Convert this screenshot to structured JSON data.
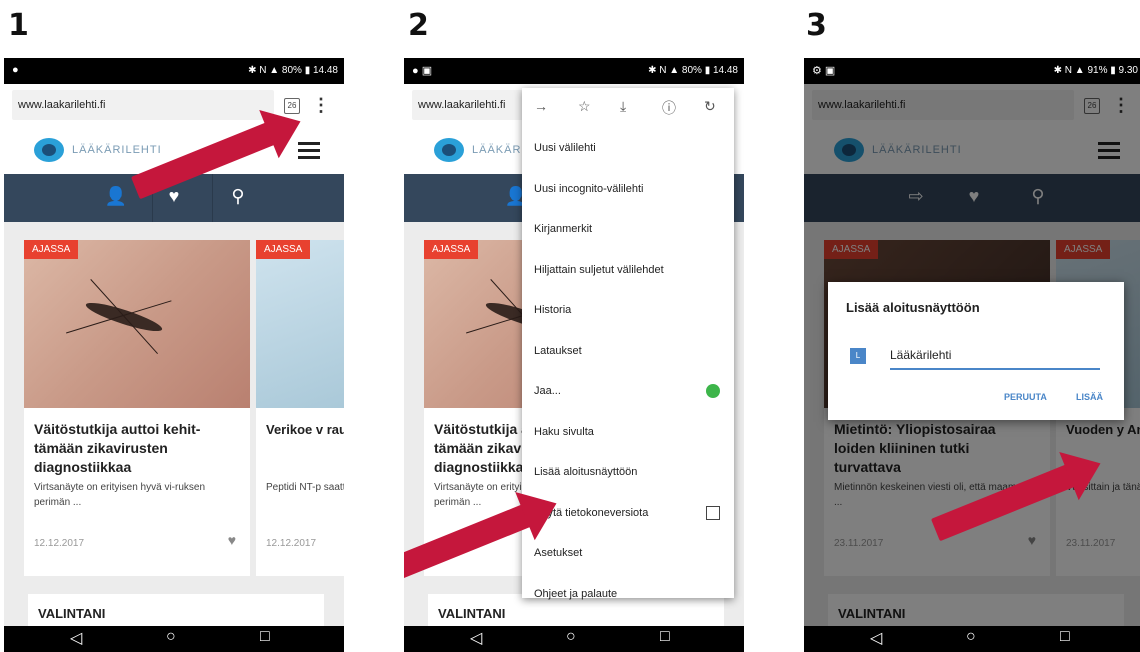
{
  "steps": [
    "1",
    "2",
    "3"
  ],
  "status": {
    "p1": "✱ N ▲ 80% ▮ 14.48",
    "p2": "✱ N ▲ 80% ▮ 14.48",
    "p3": "✱ N ▲ 91% ▮ 9.30"
  },
  "url": "www.laakarilehti.fi",
  "logo_text": "LÄÄKÄRILEHTI",
  "tabs_count": "26",
  "nav_icons": [
    "user-icon",
    "heart-icon",
    "search-icon"
  ],
  "nav_icons_p3": [
    "logout-icon",
    "heart-icon",
    "search-icon"
  ],
  "article1": {
    "tag": "AJASSA",
    "title": "Väitöstutkija auttoi kehit-tämään zikavirusten diagnostiikkaa",
    "desc": "Virtsanäyte on erityisen hyvä vi-ruksen perimän ...",
    "date": "12.12.2017"
  },
  "article2": {
    "tag": "AJASSA",
    "title": "Verikoe v rauden ris kemmin",
    "desc": "Peptidi NT-p saattavat oll",
    "date": "12.12.2017"
  },
  "article1_p3": {
    "tag": "AJASSA",
    "title": "Mietintö: Yliopistosairaa loiden kliininen tutki turvattava",
    "desc": "Mietinnön keskeinen viesti oli, että maamme ...",
    "date": "23.11.2017"
  },
  "article2_p3": {
    "tag": "AJASSA",
    "title": "Vuoden y Anneli Ku",
    "desc": "Vuosittain ja tänään Helsi Yleislääkärip",
    "date": "23.11.2017"
  },
  "section_title": "VALINTANI",
  "menu": {
    "items": [
      "Uusi välilehti",
      "Uusi incognito-välilehti",
      "Kirjanmerkit",
      "Hiljattain suljetut välilehdet",
      "Historia",
      "Lataukset",
      "Jaa...",
      "Haku sivulta",
      "Lisää aloitusnäyttöön",
      "Käytä tietokoneversiota",
      "Asetukset",
      "Ohjeet ja palaute"
    ]
  },
  "dialog": {
    "title": "Lisää aloitusnäyttöön",
    "favicon": "L",
    "value": "Lääkärilehti",
    "cancel": "PERUUTA",
    "add": "LISÄÄ"
  },
  "colors": {
    "nav": "#34475c",
    "tag": "#e8412f",
    "arrow": "#c5173c",
    "accent": "#4a86c8"
  }
}
